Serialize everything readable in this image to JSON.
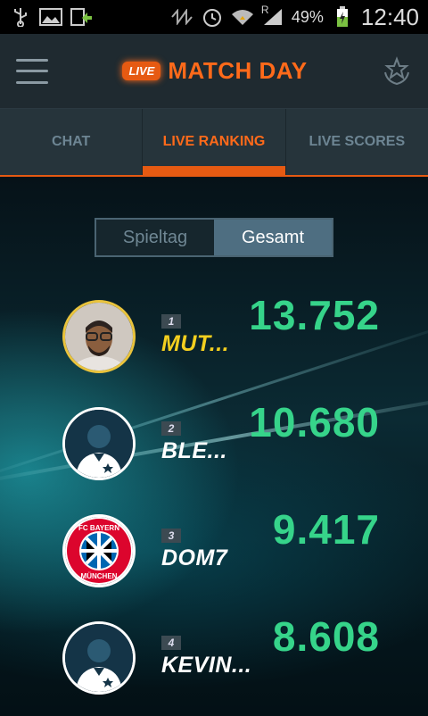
{
  "statusbar": {
    "time": "12:40",
    "battery_percent": "49%",
    "roaming_label": "R"
  },
  "appbar": {
    "live_badge": "LIVE",
    "title": "MATCH DAY"
  },
  "tabs": [
    {
      "label": "CHAT",
      "active": false
    },
    {
      "label": "LIVE RANKING",
      "active": true
    },
    {
      "label": "LIVE SCORES",
      "active": false
    }
  ],
  "segment": {
    "left": "Spieltag",
    "right": "Gesamt",
    "selected": "Gesamt"
  },
  "ranking": [
    {
      "rank": "1",
      "name": "MUT...",
      "score": "13.752",
      "avatar": "user-photo",
      "highlight": true
    },
    {
      "rank": "2",
      "name": "BLE...",
      "score": "10.680",
      "avatar": "default-player",
      "highlight": false
    },
    {
      "rank": "3",
      "name": "DOM7",
      "score": "9.417",
      "avatar": "fc-bayern-crest",
      "highlight": false
    },
    {
      "rank": "4",
      "name": "KEVIN...",
      "score": "8.608",
      "avatar": "default-player",
      "highlight": false
    }
  ],
  "crest_text": {
    "top": "FC BAYERN",
    "bottom": "MÜNCHEN"
  },
  "colors": {
    "accent": "#e65a12",
    "score": "#36d48a",
    "highlight_name": "#f3cf1f"
  }
}
